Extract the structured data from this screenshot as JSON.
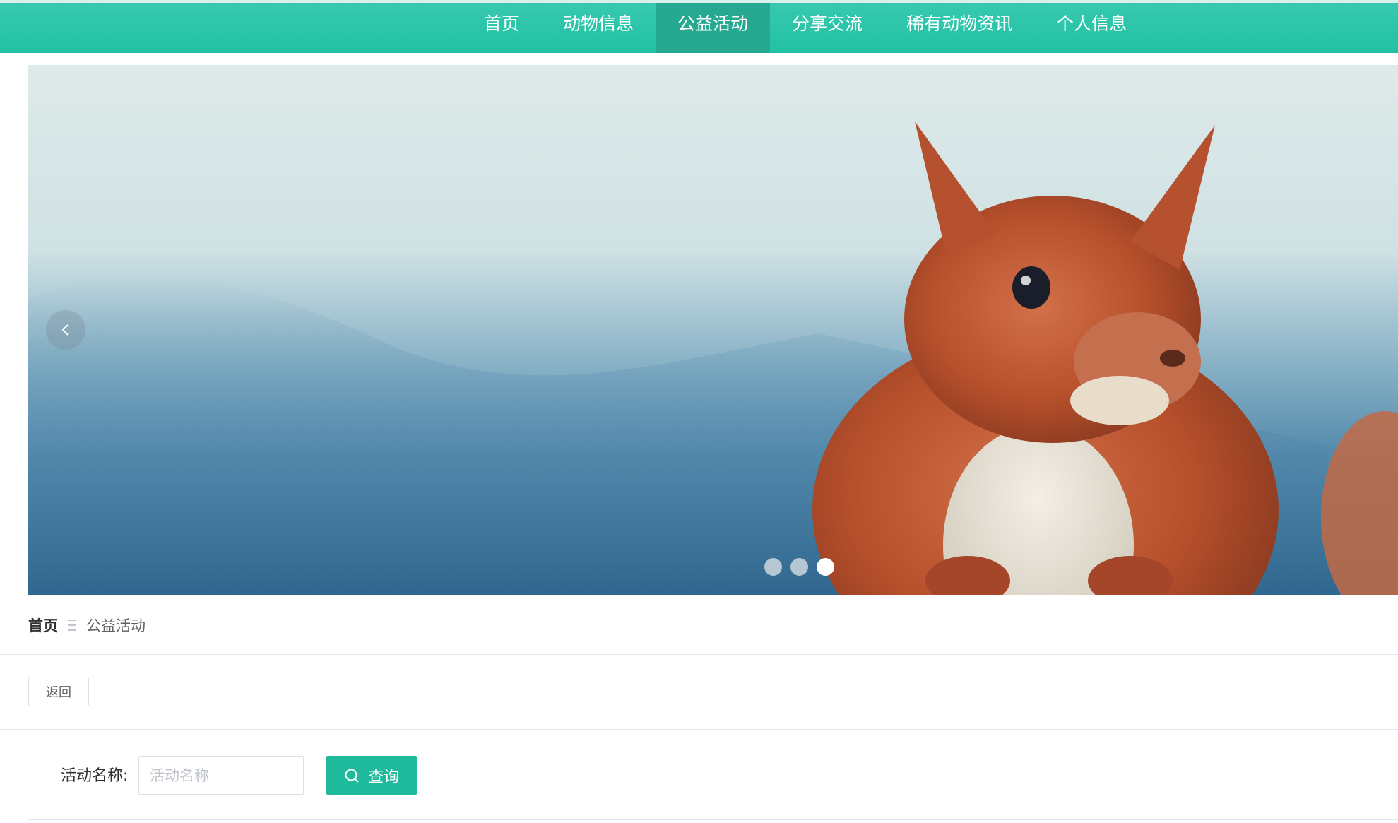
{
  "nav": {
    "items": [
      {
        "label": "首页",
        "active": false
      },
      {
        "label": "动物信息",
        "active": false
      },
      {
        "label": "公益活动",
        "active": true
      },
      {
        "label": "分享交流",
        "active": false
      },
      {
        "label": "稀有动物资讯",
        "active": false
      },
      {
        "label": "个人信息",
        "active": false
      }
    ]
  },
  "banner": {
    "prev_icon": "chevron-left-icon",
    "slide_count": 3,
    "active_slide": 3
  },
  "breadcrumb": {
    "home": "首页",
    "current": "公益活动"
  },
  "actions": {
    "back_label": "返回"
  },
  "search": {
    "label": "活动名称:",
    "placeholder": "活动名称",
    "value": "",
    "button_label": "查询",
    "button_icon": "search-icon"
  },
  "colors": {
    "nav_bg": "#22c1a4",
    "nav_active": "#27a891",
    "primary": "#1fba9c"
  }
}
